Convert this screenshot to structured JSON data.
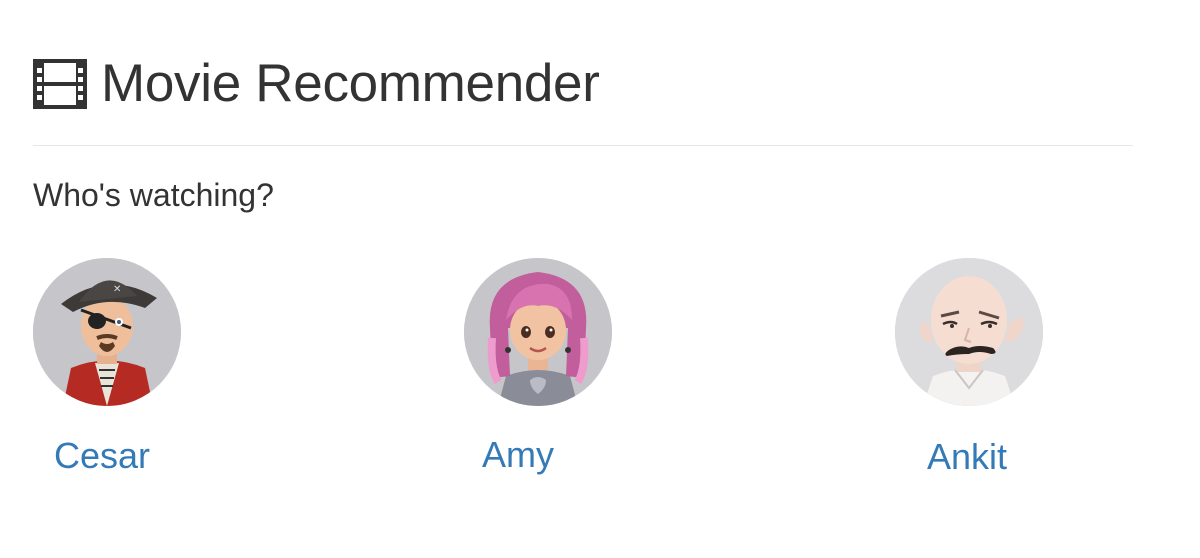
{
  "app": {
    "title": "Movie Recommender",
    "icon": "film-icon"
  },
  "prompt": "Who's watching?",
  "profiles": [
    {
      "name": "Cesar",
      "avatar": "pirate-avatar-icon"
    },
    {
      "name": "Amy",
      "avatar": "pink-hair-girl-avatar-icon"
    },
    {
      "name": "Ankit",
      "avatar": "bald-mustache-avatar-icon"
    }
  ],
  "colors": {
    "text": "#333333",
    "link": "#337ab7",
    "divider": "#e7e7e7",
    "avatar_bg": "#c9c9cc"
  }
}
